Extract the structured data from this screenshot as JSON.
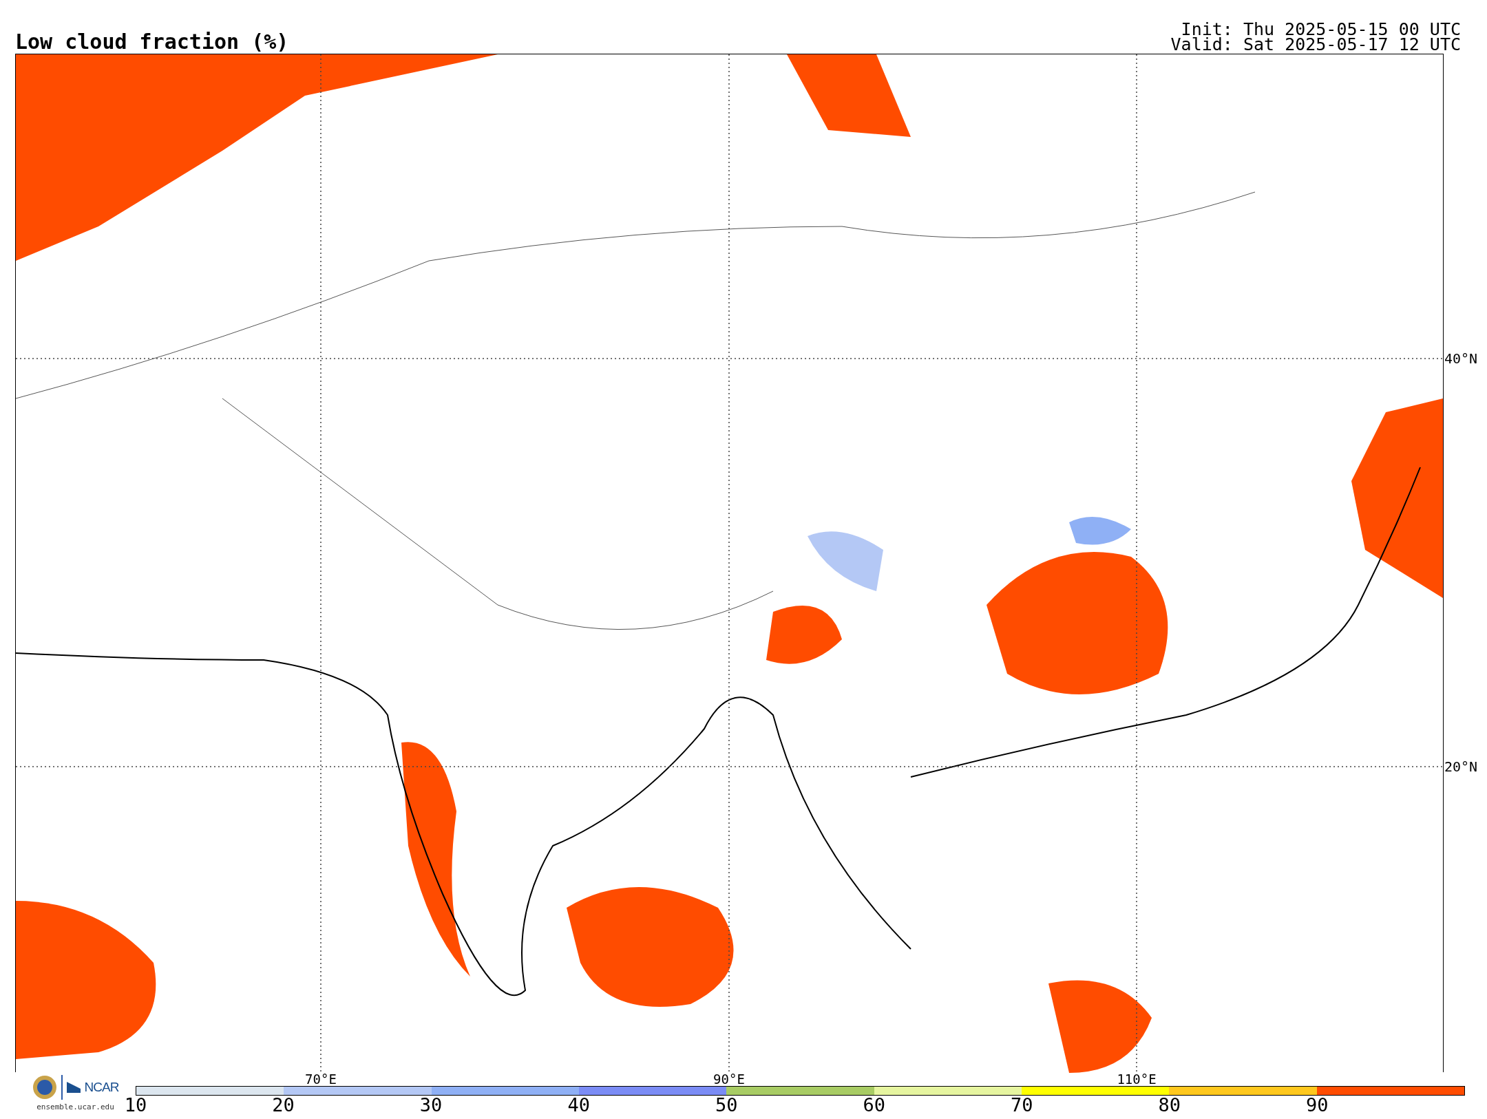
{
  "title": "Low cloud fraction (%)",
  "run_info": [
    "Init: Thu 2025-05-15 00 UTC",
    "Valid: Sat 2025-05-17 12 UTC"
  ],
  "map": {
    "longitude_labels": [
      "70°E",
      "90°E",
      "110°E"
    ],
    "latitude_labels": [
      "40°N",
      "20°N"
    ]
  },
  "logo": {
    "text": "NCAR",
    "url": "ensemble.ucar.edu"
  },
  "colorbar": [
    {
      "label": "10",
      "color": "#dce6ef"
    },
    {
      "label": "20",
      "color": "#b4c8f5"
    },
    {
      "label": "30",
      "color": "#8fb0f5"
    },
    {
      "label": "40",
      "color": "#7b8cf5"
    },
    {
      "label": "50",
      "color": "#a8cc64"
    },
    {
      "label": "60",
      "color": "#e6f5a0"
    },
    {
      "label": "70",
      "color": "#ffff00"
    },
    {
      "label": "80",
      "color": "#ffc81e"
    },
    {
      "label": "90",
      "color": "#ff4c00"
    }
  ]
}
